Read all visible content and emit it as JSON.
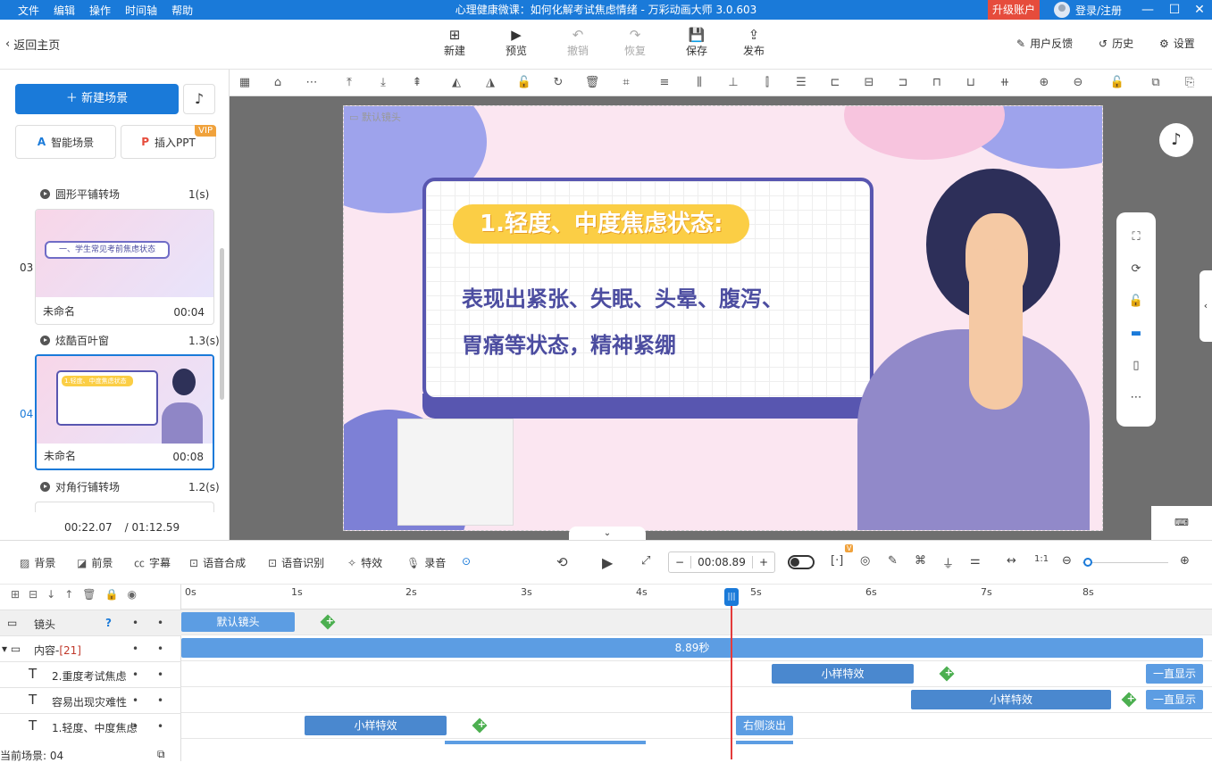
{
  "menu": [
    "文件",
    "编辑",
    "操作",
    "时间轴",
    "帮助"
  ],
  "window_title": "心理健康微课：如何化解考试焦虑情绪 - 万彩动画大师 3.0.603",
  "upgrade_label": "升级账户",
  "login_label": "登录/注册",
  "back_label": "返回主页",
  "toolbar": {
    "new": "新建",
    "preview": "预览",
    "undo": "撤销",
    "redo": "恢复",
    "save": "保存",
    "publish": "发布"
  },
  "top_right": {
    "feedback": "用户反馈",
    "history": "历史",
    "settings": "设置"
  },
  "left": {
    "new_scene": "新建场景",
    "smart_scene": "智能场景",
    "insert_ppt": "插入PPT",
    "vip": "VIP",
    "transitions": [
      {
        "name": "圆形平铺转场",
        "dur": "1(s)"
      },
      {
        "name": "炫酷百叶窗",
        "dur": "1.3(s)"
      },
      {
        "name": "对角行铺转场",
        "dur": "1.2(s)"
      }
    ],
    "scenes": [
      {
        "num": "03",
        "name": "未命名",
        "time": "00:04",
        "thumb_text": "一、学生常见考前焦虑状态"
      },
      {
        "num": "04",
        "name": "未命名",
        "time": "00:08",
        "thumb_text": "1.轻度、中度焦虑状态"
      }
    ],
    "elapsed": "00:22.07",
    "total": "/ 01:12.59"
  },
  "stage": {
    "lens_label": "默认镜头",
    "heading": "1.轻度、中度焦虑状态:",
    "line1": "表现出紧张、失眠、头晕、腹泻、",
    "line2": "胃痛等状态，精神紧绷"
  },
  "timeline_tools": {
    "bg": "背景",
    "fg": "前景",
    "subtitle": "字幕",
    "tts": "语音合成",
    "asr": "语音识别",
    "fx": "特效",
    "record": "录音",
    "time": "00:08.89",
    "ratio": "1:1",
    "v_badge": "V"
  },
  "ruler": [
    "0s",
    "1s",
    "2s",
    "3s",
    "4s",
    "5s",
    "6s",
    "7s",
    "8s"
  ],
  "tracks": [
    {
      "label": "镜头"
    },
    {
      "label": "内容-",
      "count": "[21]"
    },
    {
      "label": "2.重度考试焦虑"
    },
    {
      "label": "容易出现灾难性"
    },
    {
      "label": "1.轻度、中度焦虑"
    }
  ],
  "clips": {
    "lens": "默认镜头",
    "content": "8.89秒",
    "fx1": "小样特效",
    "always1": "一直显示",
    "fx2": "小样特效",
    "always2": "一直显示",
    "fx3": "小样特效",
    "fadeout": "右侧淡出"
  },
  "status": "当前场景: 04"
}
